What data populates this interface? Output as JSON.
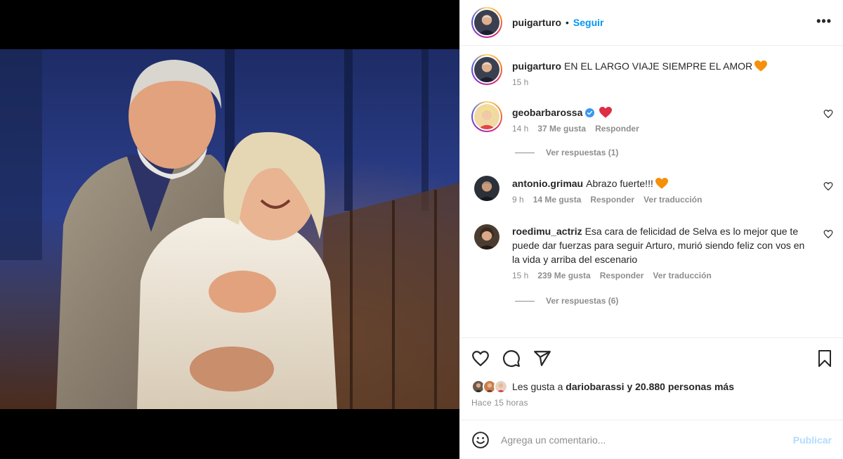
{
  "post": {
    "author": "puigarturo",
    "follow_label": "Seguir",
    "more_label": "•••",
    "caption_user": "puigarturo",
    "caption_text": "EN EL LARGO VIAJE SIEMPRE EL AMOR",
    "caption_time": "15 h"
  },
  "comments": [
    {
      "user": "geobarbarossa",
      "verified": true,
      "text": "",
      "emoji": "red-heart",
      "time": "14 h",
      "likes": "37 Me gusta",
      "reply": "Responder",
      "translate": "",
      "view_replies": "Ver respuestas (1)"
    },
    {
      "user": "antonio.grimau",
      "verified": false,
      "text": "Abrazo fuerte!!!",
      "emoji": "orange-heart",
      "time": "9 h",
      "likes": "14 Me gusta",
      "reply": "Responder",
      "translate": "Ver traducción",
      "view_replies": ""
    },
    {
      "user": "roedimu_actriz",
      "verified": false,
      "text": "Esa cara de felicidad de Selva es lo mejor que te puede dar fuerzas para seguir Arturo, murió siendo feliz con vos en la vida y arriba del escenario",
      "emoji": "",
      "time": "15 h",
      "likes": "239 Me gusta",
      "reply": "Responder",
      "translate": "Ver traducción",
      "view_replies": "Ver respuestas (6)"
    }
  ],
  "engagement": {
    "liked_by_prefix": "Les gusta a",
    "liked_by_user": "dariobarassi",
    "liked_by_suffix": "y 20.880 personas más",
    "time_ago": "Hace 15 horas"
  },
  "add_comment": {
    "placeholder": "Agrega un comentario...",
    "publish_label": "Publicar"
  },
  "icons": [
    "heart-icon",
    "comment-icon",
    "share-icon",
    "bookmark-icon",
    "emoji-icon",
    "more-icon"
  ],
  "colors": {
    "link_blue": "#0095f6",
    "publish_disabled": "#b3dbff",
    "muted": "#8e8e8e",
    "orange_heart": "#f4900c",
    "red_heart": "#dd2e44",
    "verified_blue": "#3897f0"
  }
}
